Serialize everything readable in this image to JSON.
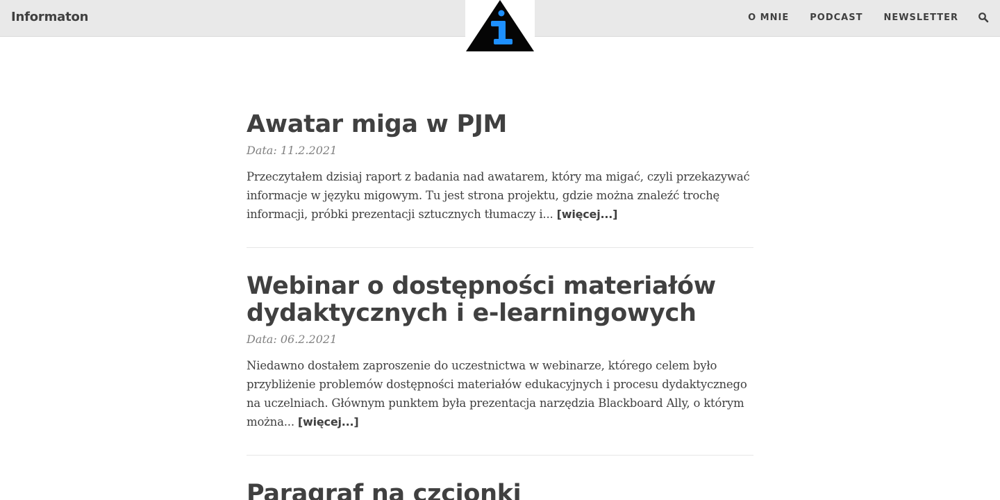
{
  "navbar": {
    "brand": "Informaton",
    "links": [
      "O MNIE",
      "PODCAST",
      "NEWSLETTER"
    ]
  },
  "posts": [
    {
      "title": "Awatar miga w PJM",
      "meta": "Data: 11.2.2021",
      "excerpt": "Przeczytałem dzisiaj raport z badania nad awatarem, który ma migać, czyli przekazywać informacje w języku migowym. Tu jest strona projektu, gdzie można znaleźć trochę informacji, próbki prezentacji sztucznych tłumaczy i...",
      "read_more": "[więcej...]"
    },
    {
      "title": "Webinar o dostępności materiałów dydaktycznych i e-learningowych",
      "meta": "Data: 06.2.2021",
      "excerpt": "Niedawno dostałem zaproszenie do uczestnictwa w webinarze, którego celem było przybliżenie problemów dostępności materiałów edukacyjnych i procesu dydaktycznego na uczelniach. Głównym punktem była prezentacja narzędzia Blackboard Ally, o którym można...",
      "read_more": "[więcej...]"
    },
    {
      "title": "Paragraf na czcionki"
    }
  ],
  "colors": {
    "navbar_bg": "#e9e9e9",
    "text": "#404040",
    "meta": "#808080",
    "logo_accent": "#1e90ff"
  },
  "icons": {
    "logo": "info-triangle-logo",
    "search": "search-icon"
  }
}
